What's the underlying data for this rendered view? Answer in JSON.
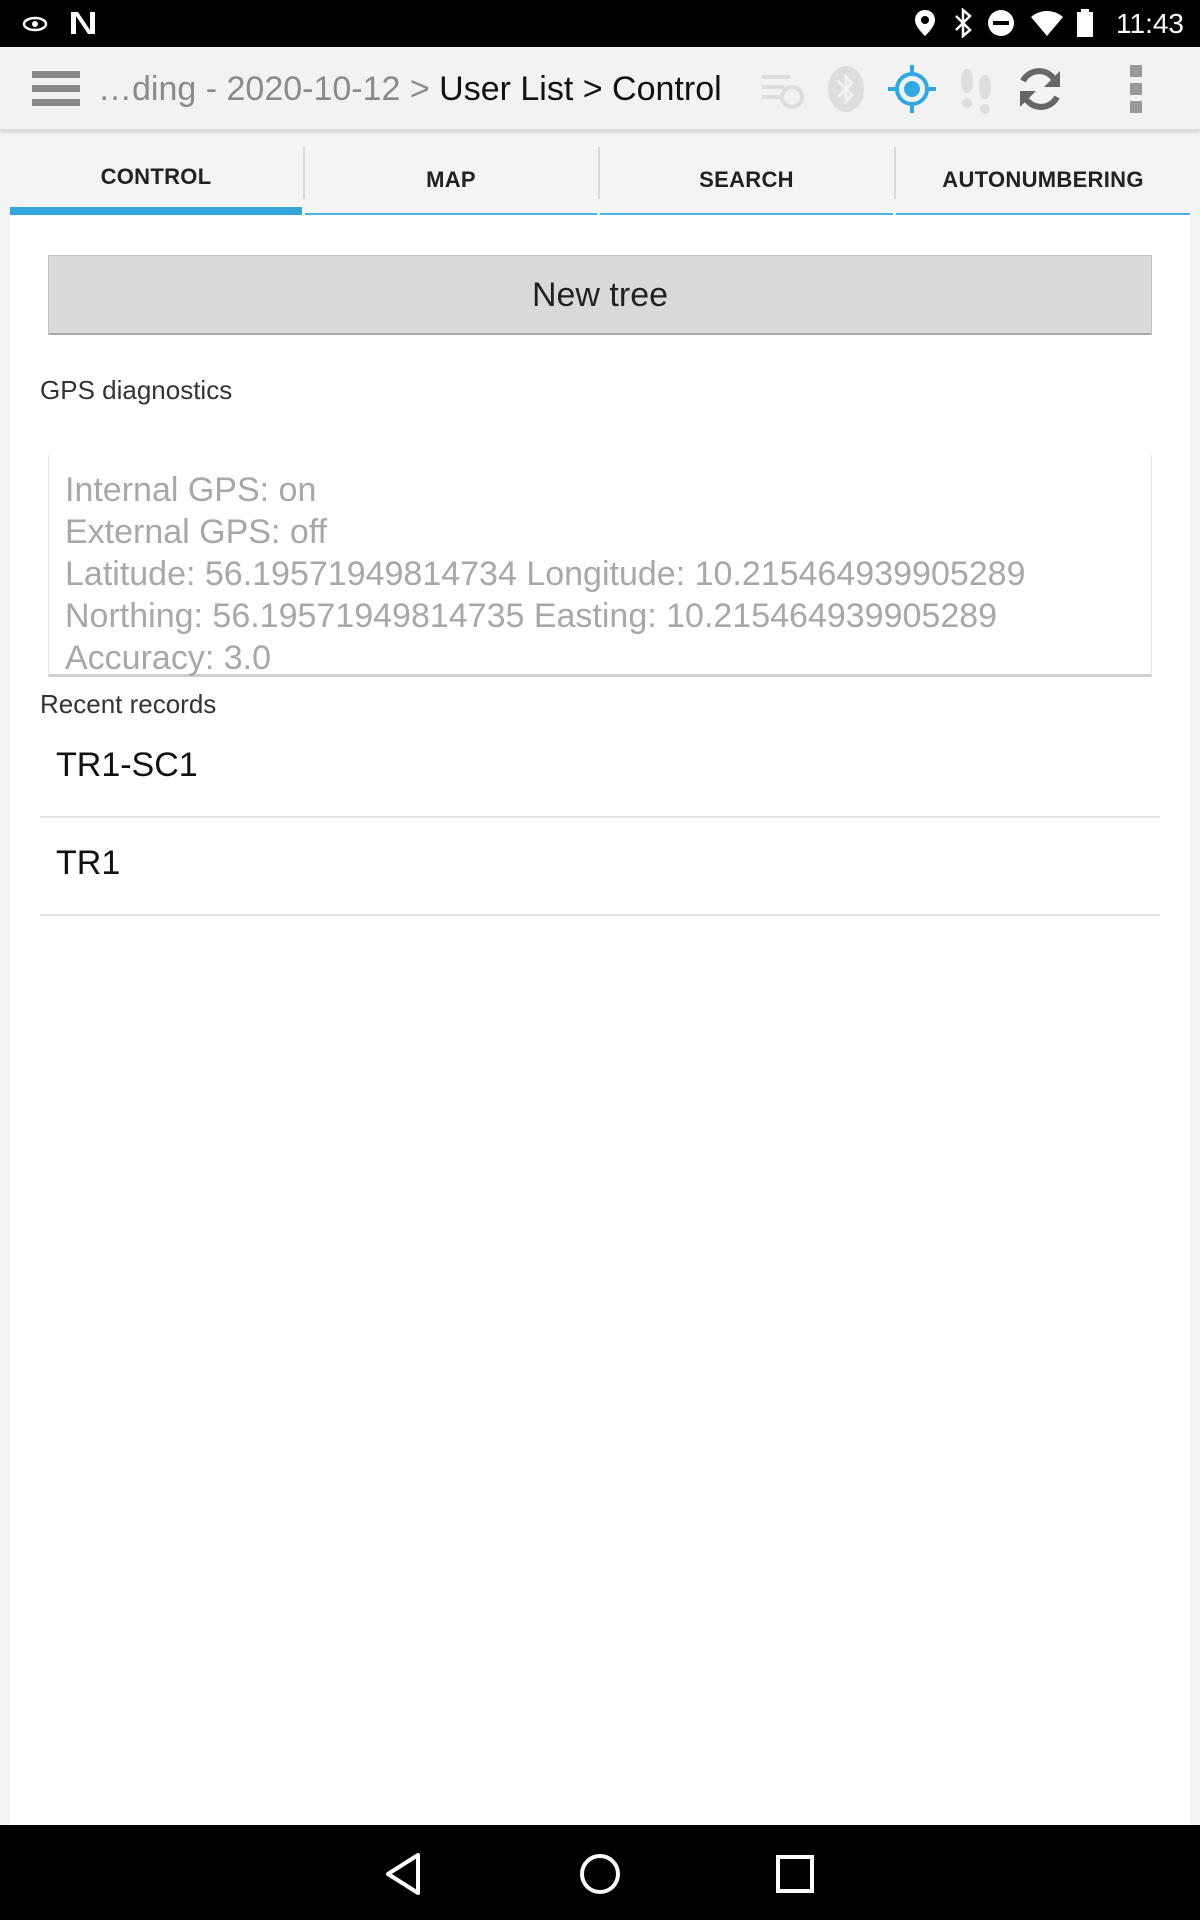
{
  "status_bar": {
    "time": "11:43",
    "icons": [
      "eye-icon",
      "n-logo-icon",
      "location-pin-icon",
      "bluetooth-icon",
      "do-not-disturb-icon",
      "wifi-icon",
      "battery-icon"
    ]
  },
  "action_bar": {
    "breadcrumb_dim": "…ding - 2020-10-12 >",
    "breadcrumb_main": " User List > Control",
    "icons": [
      "menu-icon",
      "sync-disabled-icon",
      "bluetooth-disabled-icon",
      "gps-icon",
      "footsteps-icon",
      "refresh-icon",
      "overflow-icon"
    ],
    "gps_color": "#33a8e0"
  },
  "tabs": [
    {
      "label": "CONTROL",
      "active": true
    },
    {
      "label": "MAP",
      "active": false
    },
    {
      "label": "SEARCH",
      "active": false
    },
    {
      "label": "AUTONUMBERING",
      "active": false
    }
  ],
  "main": {
    "new_tree_label": "New tree",
    "gps_section_label": "GPS diagnostics",
    "gps_lines": [
      "Internal GPS: on",
      "External GPS: off",
      "Latitude: 56.19571949814734   Longitude: 10.215464939905289",
      "Northing: 56.19571949814735   Easting: 10.215464939905289",
      "Accuracy: 3.0"
    ],
    "recent_section_label": "Recent records",
    "records": [
      "TR1-SC1",
      "TR1"
    ]
  },
  "nav_bar": {
    "icons": [
      "back-icon",
      "home-icon",
      "recents-icon"
    ]
  }
}
